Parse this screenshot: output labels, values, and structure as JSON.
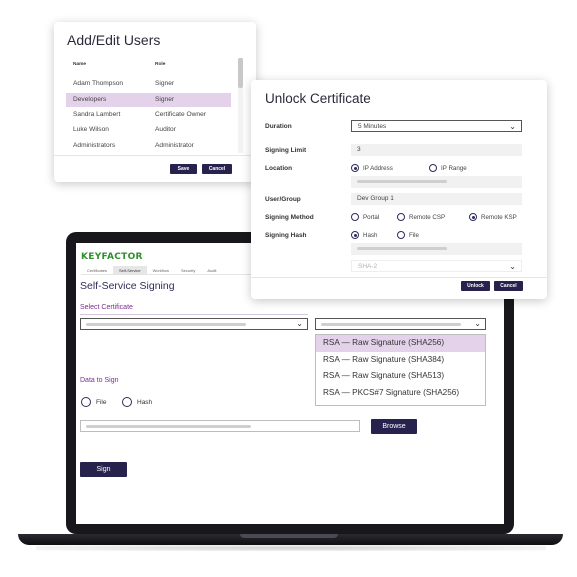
{
  "laptop": {
    "logo": "KEYFACTOR",
    "nav_tabs": [
      "Certificates",
      "Self-Service",
      "Workflow",
      "Security",
      "Audit"
    ],
    "page_title": "Self-Service Signing",
    "select_certificate_label": "Select Certificate",
    "signature_options": [
      "RSA — Raw Signature (SHA256)",
      "RSA — Raw Signature (SHA384)",
      "RSA — Raw Signature (SHA513)",
      "RSA — PKCS#7 Signature (SHA256)"
    ],
    "selected_option_index": 0,
    "data_to_sign_label": "Data to Sign",
    "radio_file": "File",
    "radio_hash": "Hash",
    "browse_label": "Browse",
    "sign_label": "Sign"
  },
  "users_dialog": {
    "title": "Add/Edit Users",
    "col_name": "Name",
    "col_role": "Role",
    "rows": [
      {
        "name": "Adam Thompson",
        "role": "Signer"
      },
      {
        "name": "Developers",
        "role": "Signer"
      },
      {
        "name": "Sandra Lambert",
        "role": "Certificate Owner"
      },
      {
        "name": "Luke Wilson",
        "role": "Auditor"
      },
      {
        "name": "Administrators",
        "role": "Administrator"
      }
    ],
    "selected_row_index": 1,
    "save_label": "Save",
    "cancel_label": "Cancel"
  },
  "unlock_dialog": {
    "title": "Unlock Certificate",
    "duration_label": "Duration",
    "duration_value": "5 Minutes",
    "signing_limit_label": "Signing Limit",
    "signing_limit_value": "3",
    "location_label": "Location",
    "location_ip_address": "IP Address",
    "location_ip_range": "IP Range",
    "user_group_label": "User/Group",
    "user_group_value": "Dev Group 1",
    "signing_method_label": "Signing Method",
    "method_portal": "Portal",
    "method_remote_csp": "Remote CSP",
    "method_remote_ksp": "Remote KSP",
    "signing_hash_label": "Signing Hash",
    "hash_option": "Hash",
    "file_option": "File",
    "hash_algorithm": "SHA-2",
    "unlock_label": "Unlock",
    "cancel_label": "Cancel"
  },
  "colors": {
    "primary_button": "#27214e",
    "accent_purple": "#7a2e8e",
    "selection_highlight": "#e4d2ea",
    "logo_green": "#2f8f2f"
  }
}
